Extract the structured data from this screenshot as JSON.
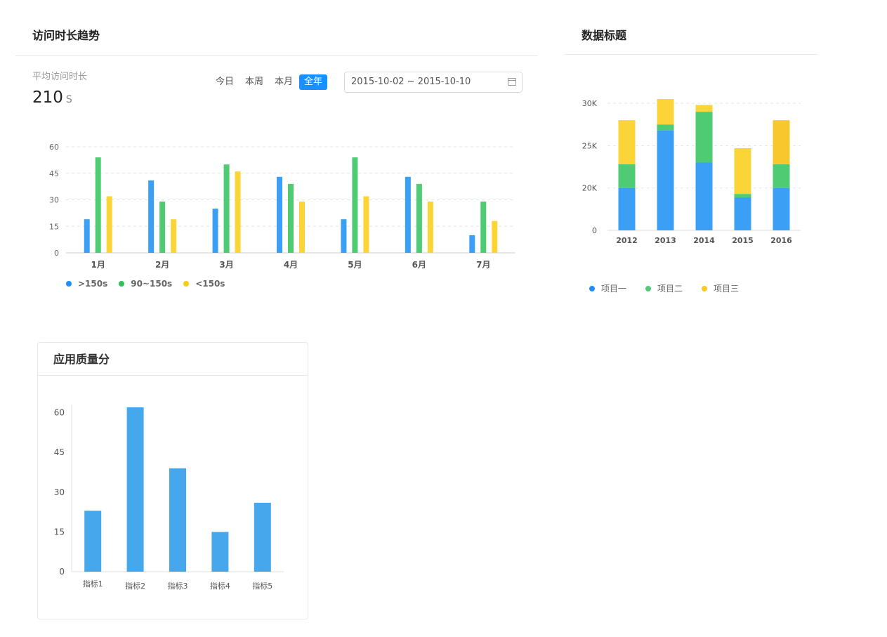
{
  "panel1": {
    "title": "访问时长趋势",
    "metric_label": "平均访问时长",
    "metric_value": "210",
    "metric_unit": "S",
    "range_buttons": [
      "今日",
      "本周",
      "本月",
      "全年"
    ],
    "active_range": 3,
    "date_range": "2015-10-02 ~ 2015-10-10",
    "calendar_icon": "calendar-icon"
  },
  "panel2": {
    "title": "数据标题"
  },
  "panel3": {
    "title": "应用质量分"
  },
  "colors": {
    "blue": "#3a9ff5",
    "green": "#4fcb73",
    "yellow": "#fbd437",
    "yellow2": "#f8c72d",
    "bar3": "#47a7ed",
    "active_button": "#1890ff"
  },
  "chart_data": [
    {
      "type": "bar",
      "categories": [
        "1月",
        "2月",
        "3月",
        "4月",
        "5月",
        "6月",
        "7月"
      ],
      "series": [
        {
          "name": ">150s",
          "values": [
            19,
            41,
            25,
            43,
            19,
            43,
            10
          ]
        },
        {
          "name": "90~150s",
          "values": [
            54,
            29,
            50,
            39,
            54,
            39,
            29
          ]
        },
        {
          "name": "<150s",
          "values": [
            32,
            19,
            46,
            29,
            32,
            29,
            18
          ]
        }
      ],
      "yticks": [
        0,
        15,
        30,
        45,
        60
      ],
      "ylim": [
        0,
        60
      ],
      "grid": true,
      "legend": "bottom-left"
    },
    {
      "type": "bar",
      "stacked": true,
      "categories": [
        "2012",
        "2013",
        "2014",
        "2015",
        "2016"
      ],
      "series": [
        {
          "name": "项目一",
          "values": [
            20000,
            26800,
            23000,
            18900,
            20000
          ]
        },
        {
          "name": "项目二",
          "values": [
            2800,
            700,
            6000,
            400,
            2800
          ]
        },
        {
          "name": "项目三",
          "values": [
            5200,
            3000,
            800,
            5400,
            5200
          ]
        }
      ],
      "yticks": [
        "0",
        "20K",
        "25K",
        "30K"
      ],
      "ylim": [
        0,
        31000
      ],
      "grid": true,
      "legend": "bottom-left"
    },
    {
      "type": "bar",
      "categories": [
        "指标1",
        "指标2",
        "指标3",
        "指标4",
        "指标5"
      ],
      "values": [
        23,
        62,
        39,
        15,
        26
      ],
      "yticks": [
        0,
        15,
        30,
        45,
        60
      ],
      "ylim": [
        0,
        62
      ],
      "grid": false
    }
  ]
}
